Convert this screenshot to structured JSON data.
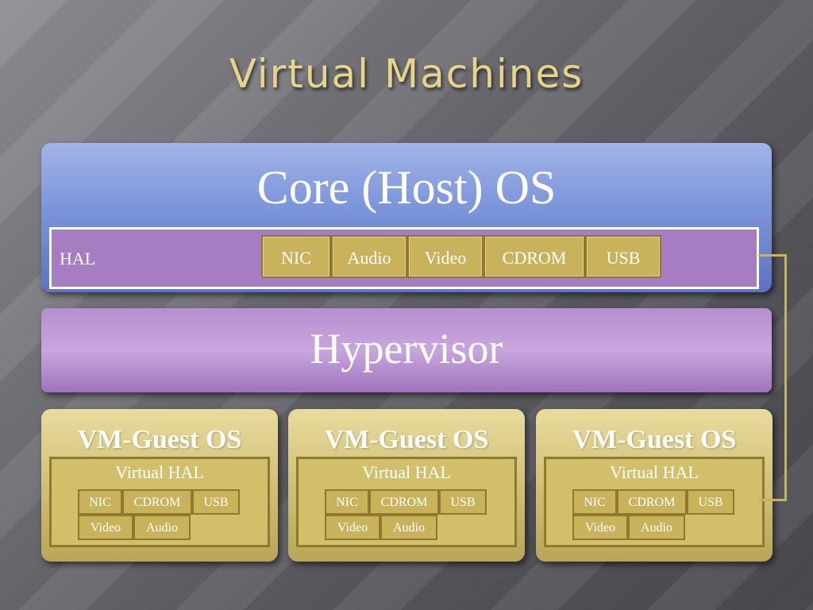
{
  "title": "Virtual Machines",
  "host": {
    "title": "Core (Host) OS",
    "hal_label": "HAL",
    "devices": [
      "NIC",
      "Audio",
      "Video",
      "CDROM",
      "USB"
    ]
  },
  "hypervisor": {
    "title": "Hypervisor"
  },
  "guests": [
    {
      "title": "VM-Guest OS",
      "hal_label": "Virtual HAL",
      "devices_row1": [
        "NIC",
        "CDROM",
        "USB"
      ],
      "devices_row2": [
        "Video",
        "Audio"
      ]
    },
    {
      "title": "VM-Guest OS",
      "hal_label": "Virtual HAL",
      "devices_row1": [
        "NIC",
        "CDROM",
        "USB"
      ],
      "devices_row2": [
        "Video",
        "Audio"
      ]
    },
    {
      "title": "VM-Guest OS",
      "hal_label": "Virtual HAL",
      "devices_row1": [
        "NIC",
        "CDROM",
        "USB"
      ],
      "devices_row2": [
        "Video",
        "Audio"
      ]
    }
  ],
  "colors": {
    "title_gold": "#e6d488",
    "host_blue": "#7f97dc",
    "hal_purple": "#a67cc2",
    "hypervisor_purple": "#b58fcf",
    "guest_gold": "#d4c27a",
    "device_gold": "#c8b35c"
  }
}
